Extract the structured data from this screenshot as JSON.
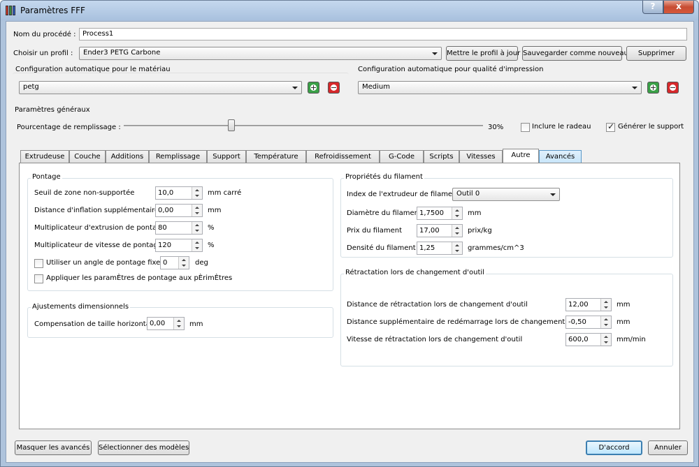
{
  "window": {
    "title": "Paramètres FFF",
    "help_label": "?",
    "close_label": "x"
  },
  "process": {
    "label": "Nom du procédé :",
    "value": "Process1"
  },
  "profile": {
    "label": "Choisir un profil :",
    "value": "Ender3 PETG Carbone",
    "update_btn": "Mettre le profil à jour",
    "save_new_btn": "Sauvegarder comme nouveau",
    "delete_btn": "Supprimer"
  },
  "material_auto": {
    "title": "Configuration automatique pour le matériau",
    "value": "petg"
  },
  "quality_auto": {
    "title": "Configuration automatique pour qualité d'impression",
    "value": "Medium"
  },
  "general": {
    "title": "Paramètres généraux",
    "infill_label": "Pourcentage de remplissage :",
    "infill_value": "30%",
    "infill_fraction": 0.3,
    "raft_label": "Inclure le radeau",
    "raft_checked": false,
    "support_label": "Générer le support",
    "support_checked": true
  },
  "tabs": [
    {
      "label": "Extrudeuse"
    },
    {
      "label": "Couche"
    },
    {
      "label": "Additions"
    },
    {
      "label": "Remplissage"
    },
    {
      "label": "Support"
    },
    {
      "label": "Température"
    },
    {
      "label": "Refroidissement"
    },
    {
      "label": "G-Code"
    },
    {
      "label": "Scripts"
    },
    {
      "label": "Vitesses"
    },
    {
      "label": "Autre",
      "active": true
    },
    {
      "label": "Avancés",
      "highlight": true
    }
  ],
  "bridging": {
    "title": "Pontage",
    "rows": [
      {
        "label": "Seuil de zone non-supportée",
        "value": "10,0",
        "unit": "mm carré"
      },
      {
        "label": "Distance d'inflation supplémentaire",
        "value": "0,00",
        "unit": "mm"
      },
      {
        "label": "Multiplicateur d'extrusion de pontage",
        "value": "80",
        "unit": "%"
      },
      {
        "label": "Multiplicateur de vitesse de pontage",
        "value": "120",
        "unit": "%"
      }
    ],
    "fixed_angle": {
      "label": "Utiliser un angle de pontage fixe.",
      "value": "0",
      "unit": "deg",
      "checked": false
    },
    "apply_perimeters": {
      "label": "Appliquer les paramÈtres de pontage aux pÈrimÈtres",
      "checked": false
    }
  },
  "dimensional": {
    "title": "Ajustements dimensionnels",
    "label": "Compensation de taille horizontale",
    "value": "0,00",
    "unit": "mm"
  },
  "filament": {
    "title": "Propriétés du filament",
    "extruder_label": "Index de l'extrudeur de filament",
    "extruder_value": "Outil 0",
    "rows": [
      {
        "label": "Diamètre du filament",
        "value": "1,7500",
        "unit": "mm"
      },
      {
        "label": "Prix du filament",
        "value": "17,00",
        "unit": "prix/kg"
      },
      {
        "label": "Densité du filament",
        "value": "1,25",
        "unit": "grammes/cm^3"
      }
    ]
  },
  "tool_retract": {
    "title": "Rétractation lors de changement d'outil",
    "rows": [
      {
        "label": "Distance de rétractation lors de changement d'outil",
        "value": "12,00",
        "unit": "mm"
      },
      {
        "label": "Distance supplémentaire de redémarrage lors de changement d'outil",
        "value": "-0,50",
        "unit": "mm"
      },
      {
        "label": "Vitesse de rétractation lors de changement d'outil",
        "value": "600,0",
        "unit": "mm/min"
      }
    ]
  },
  "footer": {
    "hide_advanced": "Masquer les avancés",
    "select_models": "Sélectionner des modèles",
    "ok": "D'accord",
    "cancel": "Annuler"
  },
  "colors": {
    "accent": "#3c7fb1",
    "plus": "#3aa047",
    "minus": "#d6282b"
  }
}
